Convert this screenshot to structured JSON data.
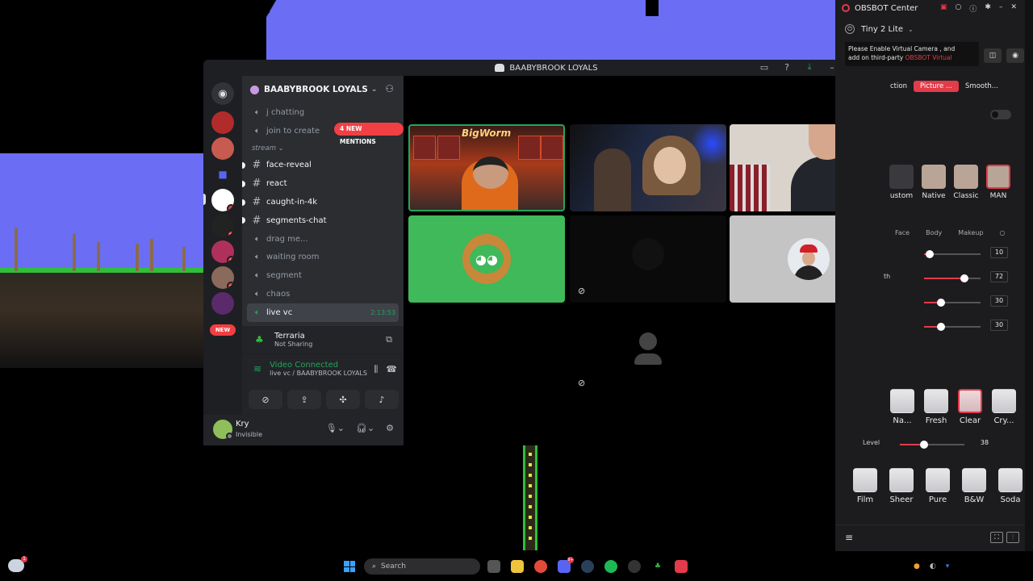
{
  "discord": {
    "window_title": "BAABYBROOK LOYALS",
    "server_name": "BAABYBROOK LOYALS",
    "mentions_pill": "4 NEW MENTIONS",
    "new_pill": "NEW",
    "server_badges": [
      "4",
      "7",
      "3",
      "2"
    ],
    "channels_top": [
      {
        "name": "j chatting",
        "type": "voice"
      },
      {
        "name": "join to create",
        "type": "voice"
      }
    ],
    "category": "stream",
    "channels": [
      {
        "name": "face-reveal",
        "type": "text",
        "unread": true
      },
      {
        "name": "react",
        "type": "text",
        "unread": true
      },
      {
        "name": "caught-in-4k",
        "type": "text",
        "unread": true
      },
      {
        "name": "segments-chat",
        "type": "text",
        "unread": true
      },
      {
        "name": "drag me...",
        "type": "voice",
        "unread": false
      },
      {
        "name": "waiting room",
        "type": "voice",
        "unread": false
      },
      {
        "name": "segment",
        "type": "voice",
        "unread": false
      },
      {
        "name": "chaos",
        "type": "voice",
        "unread": false
      }
    ],
    "active_channel": {
      "name": "live vc",
      "timer": "2:13:53"
    },
    "activity": {
      "name": "Terraria",
      "status": "Not Sharing"
    },
    "voice": {
      "status": "Video Connected",
      "location": "live vc / BAABYBROOK LOYALS"
    },
    "user": {
      "name": "Kry",
      "status": "Invisible"
    },
    "stream_overlay_text": "BigWorm"
  },
  "obsbot": {
    "title": "OBSBOT Center",
    "device": "Tiny 2 Lite",
    "tip_line1": "Please Enable Virtual Camera , and",
    "tip_line2": "add on third-party",
    "tip_highlight": "OBSBOT Virtual",
    "tabs": [
      "ction",
      "Picture ...",
      "Smooth..."
    ],
    "active_tab": "Picture ...",
    "faces": [
      "ustom",
      "Native",
      "Classic",
      "MAN"
    ],
    "active_face": "MAN",
    "subtabs": [
      "Face",
      "Body",
      "Makeup"
    ],
    "sliders": [
      {
        "label": "",
        "value": 10
      },
      {
        "label": "th",
        "value": 72
      },
      {
        "label": "",
        "value": 30
      },
      {
        "label": "",
        "value": 30
      }
    ],
    "filters_row1": [
      "Na...",
      "Fresh",
      "Clear",
      "Cry..."
    ],
    "active_filter": "Clear",
    "level": {
      "label": "Level",
      "value": 38
    },
    "filters_row2": [
      "Film",
      "Sheer",
      "Pure",
      "B&W",
      "Soda"
    ],
    "accent": "#e23b4a"
  },
  "taskbar": {
    "search_placeholder": "Search",
    "notif_badge": "1",
    "discord_badge": "9+"
  },
  "colors": {
    "discord_green": "#23a55a",
    "discord_red": "#f23f43",
    "sky": "#6b6ef4"
  }
}
